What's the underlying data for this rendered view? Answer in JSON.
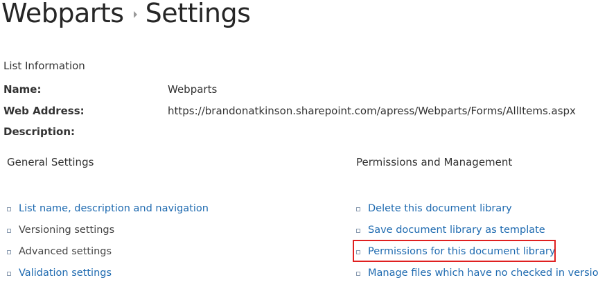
{
  "breadcrumb": {
    "parent": "Webparts",
    "current": "Settings"
  },
  "list_information": {
    "title": "List Information",
    "fields": [
      {
        "label": "Name:",
        "value": "Webparts"
      },
      {
        "label": "Web Address:",
        "value": "https://brandonatkinson.sharepoint.com/apress/Webparts/Forms/AllItems.aspx"
      },
      {
        "label": "Description:",
        "value": ""
      }
    ]
  },
  "general_settings": {
    "heading": "General Settings",
    "links": [
      {
        "label": "List name, description and navigation",
        "style": "link"
      },
      {
        "label": "Versioning settings",
        "style": "plain"
      },
      {
        "label": "Advanced settings",
        "style": "plain"
      },
      {
        "label": "Validation settings",
        "style": "link"
      }
    ]
  },
  "permissions_management": {
    "heading": "Permissions and Management",
    "links": [
      {
        "label": "Delete this document library",
        "highlighted": false
      },
      {
        "label": "Save document library as template",
        "highlighted": false
      },
      {
        "label": "Permissions for this document library",
        "highlighted": true
      },
      {
        "label": "Manage files which have no checked in version",
        "highlighted": false
      }
    ]
  },
  "colors": {
    "link": "#1e6ab0",
    "highlight_border": "#e02020",
    "bullet_border": "#8a9bb0"
  }
}
